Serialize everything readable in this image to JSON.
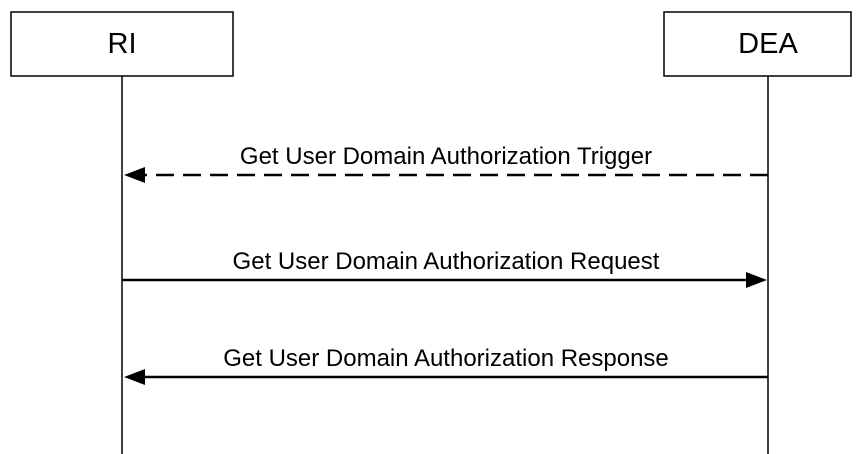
{
  "participants": [
    {
      "label": "RI"
    },
    {
      "label": "DEA"
    }
  ],
  "messages": [
    {
      "label": "Get User Domain Authorization Trigger",
      "from": "DEA",
      "to": "RI",
      "style": "dashed"
    },
    {
      "label": "Get User Domain Authorization Request",
      "from": "RI",
      "to": "DEA",
      "style": "solid"
    },
    {
      "label": "Get User Domain Authorization Response",
      "from": "DEA",
      "to": "RI",
      "style": "solid"
    }
  ],
  "colors": {
    "stroke": "#000000",
    "background": "#ffffff"
  }
}
